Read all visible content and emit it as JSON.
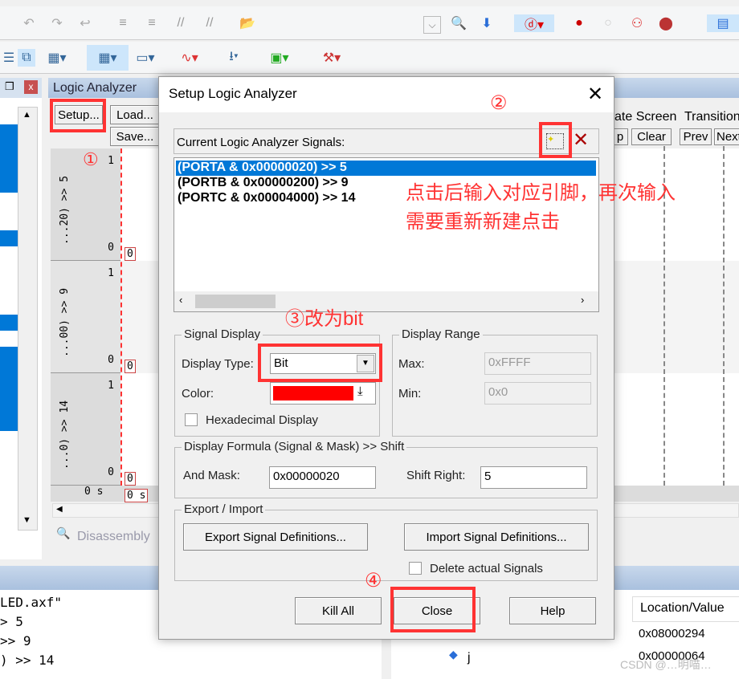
{
  "toolbar": {
    "icons": [
      "undo-icon",
      "redo-icon",
      "back-icon",
      "indent-icon",
      "unindent-icon",
      "comment-icon",
      "uncomment-icon",
      "open-folder-icon",
      "dropdown-icon",
      "find-icon",
      "download-icon",
      "debug-icon",
      "breakpoint-icon",
      "breakpoint-disabled-icon",
      "breakpoints-icon",
      "kill-breakpoints-icon",
      "window-icon"
    ]
  },
  "left_panel": {
    "pin": "❒",
    "close": "x"
  },
  "logic_analyzer": {
    "title": "Logic Analyzer",
    "setup": "Setup...",
    "load": "Load...",
    "save": "Save...",
    "signals": [
      {
        "name": "...20) >> 5",
        "max": "1",
        "min": "0",
        "value": "0"
      },
      {
        "name": "...00) >> 9",
        "max": "1",
        "min": "0",
        "value": "0"
      },
      {
        "name": "...0) >> 14",
        "max": "1",
        "min": "0",
        "value": "0"
      }
    ],
    "time": "0 s",
    "cursor_time": "0 s",
    "update_screen": "ate Screen",
    "stop": "p",
    "clear": "Clear",
    "transition": "Transition",
    "prev": "Prev",
    "next": "Next",
    "tab": "Disassembly"
  },
  "command": {
    "lines": [
      "LED.axf\"",
      "> 5",
      ">> 9",
      ") >> 14"
    ]
  },
  "watch": {
    "header": "Location/Value",
    "rows": [
      {
        "name": "",
        "value": "0x08000294"
      },
      {
        "name": "j",
        "value": "0x00000064"
      }
    ]
  },
  "dialog": {
    "title": "Setup Logic Analyzer",
    "signals_label": "Current Logic Analyzer Signals:",
    "signals": [
      "(PORTA & 0x00000020) >> 5",
      "(PORTB & 0x00000200) >> 9",
      "(PORTC & 0x00004000) >> 14"
    ],
    "selected_index": 0,
    "signal_display": {
      "legend": "Signal Display",
      "display_type_label": "Display Type:",
      "display_type": "Bit",
      "color_label": "Color:",
      "color": "#ff0000",
      "hex_label": "Hexadecimal Display",
      "hex_checked": false
    },
    "display_range": {
      "legend": "Display Range",
      "max_label": "Max:",
      "max": "0xFFFF",
      "min_label": "Min:",
      "min": "0x0"
    },
    "formula": {
      "legend": "Display Formula (Signal & Mask) >> Shift",
      "mask_label": "And Mask:",
      "mask": "0x00000020",
      "shift_label": "Shift Right:",
      "shift": "5"
    },
    "export": {
      "legend": "Export / Import",
      "export_btn": "Export Signal Definitions...",
      "import_btn": "Import Signal Definitions...",
      "delete_label": "Delete actual Signals",
      "delete_checked": false
    },
    "kill_all": "Kill All",
    "close": "Close",
    "help": "Help"
  },
  "annotations": {
    "step1": "①",
    "step2": "②",
    "step3": "③改为bit",
    "step4": "④",
    "note_line1": "点击后输入对应引脚，再次输入",
    "note_line2": "需要重新新建点击",
    "accent": "#ff3333"
  },
  "watermark": "CSDN @…明喵…"
}
